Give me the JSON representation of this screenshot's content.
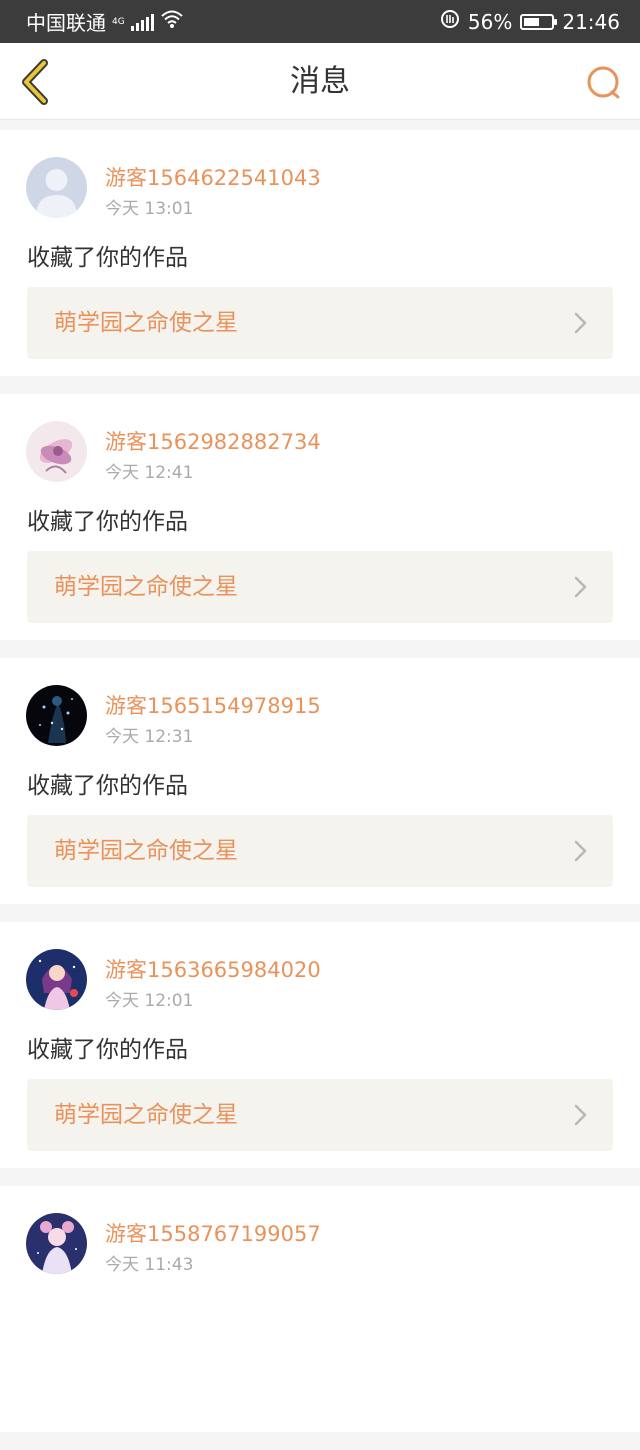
{
  "status_bar": {
    "carrier": "中国联通",
    "network": "4G",
    "battery_percent": "56%",
    "battery_level": 0.56,
    "time": "21:46"
  },
  "header": {
    "title": "消息",
    "back_icon": "chevron-left-icon",
    "search_icon": "search-icon"
  },
  "colors": {
    "accent": "#e9925a",
    "back_icon": "#e9c634",
    "text": "#333333",
    "subtext": "#aaaaaa",
    "link_bg": "#f4f3ee"
  },
  "messages": [
    {
      "username": "游客1564622541043",
      "time": "今天 13:01",
      "action": "收藏了你的作品",
      "work_title": "萌学园之命使之星",
      "avatar": "default-avatar"
    },
    {
      "username": "游客1562982882734",
      "time": "今天 12:41",
      "action": "收藏了你的作品",
      "work_title": "萌学园之命使之星",
      "avatar": "flower-avatar"
    },
    {
      "username": "游客1565154978915",
      "time": "今天 12:31",
      "action": "收藏了你的作品",
      "work_title": "萌学园之命使之星",
      "avatar": "dark-sparkle-avatar"
    },
    {
      "username": "游客1563665984020",
      "time": "今天 12:01",
      "action": "收藏了你的作品",
      "work_title": "萌学园之命使之星",
      "avatar": "anime-girl-avatar"
    },
    {
      "username": "游客1558767199057",
      "time": "今天 11:43",
      "action": "",
      "work_title": "",
      "avatar": "anime-doll-avatar"
    }
  ]
}
